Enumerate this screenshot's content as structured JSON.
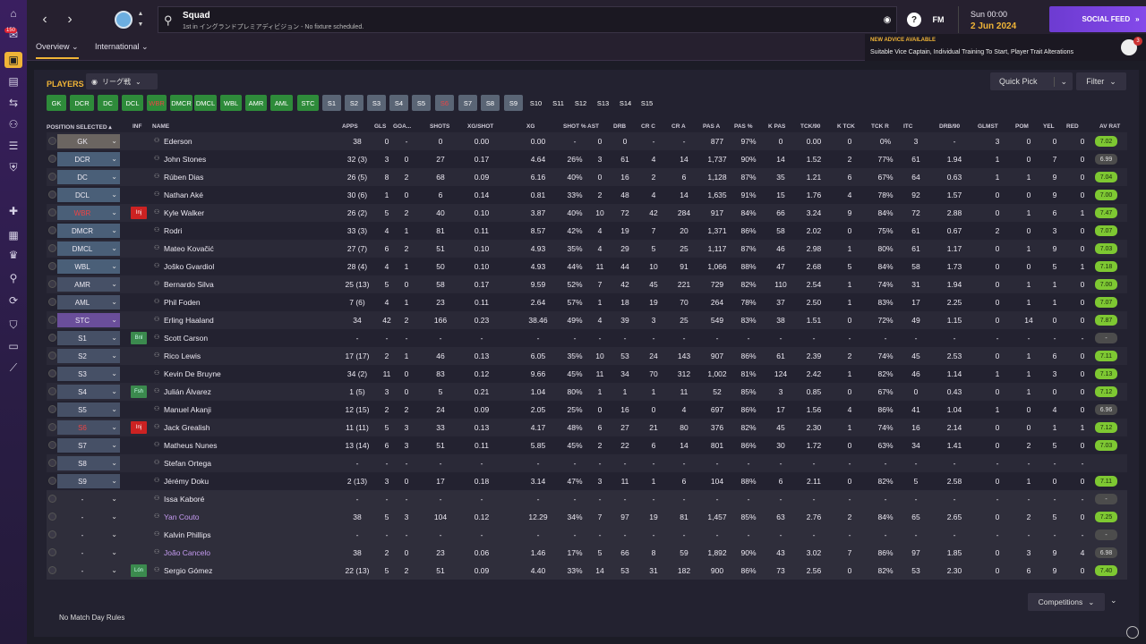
{
  "colors": {
    "accent": "#f0b437",
    "avr_good": "#7ec832",
    "avr_neutral": "#4c4c4c",
    "social": "#7a44e8"
  },
  "sidebar": {
    "badge": "150",
    "icons": [
      "home-icon",
      "inbox-icon",
      "squad-icon",
      "tactics-icon",
      "dynamics-icon",
      "staff-icon",
      "calendar-icon",
      "training-icon",
      "medical-icon",
      "schedule-icon",
      "competitions-icon",
      "scouting-icon",
      "transfers-icon",
      "club-info-icon",
      "finances-icon",
      "dev-centre-icon"
    ]
  },
  "header": {
    "title": "Squad",
    "subtitle": "1st in イングランドプレミアディビジョン - No fixture scheduled.",
    "fm_label": "FM",
    "date_line1": "Sun 00:00",
    "date_line2": "2 Jun 2024",
    "continue_label": "SOCIAL FEED",
    "tabs": [
      "Overview",
      "International"
    ],
    "advice_title": "NEW ADVICE AVAILABLE",
    "advice_text": "Suitable Vice Captain, Individual Training To Start, Player Trait Alterations",
    "advice_count": "3"
  },
  "panel": {
    "title": "PLAYERS",
    "view_label": "リーグ戦",
    "quickpick_label": "Quick Pick",
    "filter_label": "Filter",
    "positions": [
      "GK",
      "DCR",
      "DC",
      "DCL",
      "WBR",
      "DMCR",
      "DMCL",
      "WBL",
      "AMR",
      "AML",
      "STC",
      "S1",
      "S2",
      "S3",
      "S4",
      "S5",
      "S6",
      "S7",
      "S8",
      "S9",
      "S10",
      "S11",
      "S12",
      "S13",
      "S14",
      "S15"
    ],
    "columns": [
      "POSITION SELECTED",
      "INF",
      "NAME",
      "APPS",
      "GLS",
      "GOA...",
      "SHOTS",
      "XG/SHOT",
      "XG",
      "SHOT %",
      "AST",
      "DRB",
      "CR C",
      "CR A",
      "PAS A",
      "PAS %",
      "K PAS",
      "TCK/90",
      "K TCK",
      "TCK R",
      "ITC",
      "DRB/90",
      "GLMST",
      "POM",
      "YEL",
      "RED",
      "AV RAT"
    ],
    "rows": [
      {
        "pos": "GK",
        "inf": "",
        "name": "Ederson",
        "v": [
          "38",
          "0",
          "-",
          "0",
          "0.00",
          "0.00",
          "-",
          "0",
          "0",
          "-",
          "-",
          "877",
          "97%",
          "0",
          "0.00",
          "0",
          "0%",
          "3",
          "-",
          "3",
          "0",
          "0",
          "0"
        ],
        "rat": "7.02"
      },
      {
        "pos": "DCR",
        "inf": "",
        "name": "John Stones",
        "v": [
          "32 (3)",
          "3",
          "0",
          "27",
          "0.17",
          "4.64",
          "26%",
          "3",
          "61",
          "4",
          "14",
          "1,737",
          "90%",
          "14",
          "1.52",
          "2",
          "77%",
          "61",
          "1.94",
          "1",
          "0",
          "7",
          "0"
        ],
        "rat": "6.99"
      },
      {
        "pos": "DC",
        "inf": "",
        "name": "Rúben Dias",
        "v": [
          "26 (5)",
          "8",
          "2",
          "68",
          "0.09",
          "6.16",
          "40%",
          "0",
          "16",
          "2",
          "6",
          "1,128",
          "87%",
          "35",
          "1.21",
          "6",
          "67%",
          "64",
          "0.63",
          "1",
          "1",
          "9",
          "0"
        ],
        "rat": "7.04"
      },
      {
        "pos": "DCL",
        "inf": "",
        "name": "Nathan Aké",
        "v": [
          "30 (6)",
          "1",
          "0",
          "6",
          "0.14",
          "0.81",
          "33%",
          "2",
          "48",
          "4",
          "14",
          "1,635",
          "91%",
          "15",
          "1.76",
          "4",
          "78%",
          "92",
          "1.57",
          "0",
          "0",
          "9",
          "0"
        ],
        "rat": "7.00"
      },
      {
        "pos": "WBR",
        "inf": "Inj",
        "name": "Kyle Walker",
        "v": [
          "26 (2)",
          "5",
          "2",
          "40",
          "0.10",
          "3.87",
          "40%",
          "10",
          "72",
          "42",
          "284",
          "917",
          "84%",
          "66",
          "3.24",
          "9",
          "84%",
          "72",
          "2.88",
          "0",
          "1",
          "6",
          "1"
        ],
        "rat": "7.47"
      },
      {
        "pos": "DMCR",
        "inf": "",
        "name": "Rodri",
        "v": [
          "33 (3)",
          "4",
          "1",
          "81",
          "0.11",
          "8.57",
          "42%",
          "4",
          "19",
          "7",
          "20",
          "1,371",
          "86%",
          "58",
          "2.02",
          "0",
          "75%",
          "61",
          "0.67",
          "2",
          "0",
          "3",
          "0"
        ],
        "rat": "7.07"
      },
      {
        "pos": "DMCL",
        "inf": "",
        "name": "Mateo Kovačić",
        "v": [
          "27 (7)",
          "6",
          "2",
          "51",
          "0.10",
          "4.93",
          "35%",
          "4",
          "29",
          "5",
          "25",
          "1,117",
          "87%",
          "46",
          "2.98",
          "1",
          "80%",
          "61",
          "1.17",
          "0",
          "1",
          "9",
          "0"
        ],
        "rat": "7.03"
      },
      {
        "pos": "WBL",
        "inf": "",
        "name": "Joško Gvardiol",
        "v": [
          "28 (4)",
          "4",
          "1",
          "50",
          "0.10",
          "4.93",
          "44%",
          "11",
          "44",
          "10",
          "91",
          "1,066",
          "88%",
          "47",
          "2.68",
          "5",
          "84%",
          "58",
          "1.73",
          "0",
          "0",
          "5",
          "1"
        ],
        "rat": "7.18"
      },
      {
        "pos": "AMR",
        "inf": "",
        "name": "Bernardo Silva",
        "v": [
          "25 (13)",
          "5",
          "0",
          "58",
          "0.17",
          "9.59",
          "52%",
          "7",
          "42",
          "45",
          "221",
          "729",
          "82%",
          "110",
          "2.54",
          "1",
          "74%",
          "31",
          "1.94",
          "0",
          "1",
          "1",
          "0"
        ],
        "rat": "7.00"
      },
      {
        "pos": "AML",
        "inf": "",
        "name": "Phil Foden",
        "v": [
          "7 (6)",
          "4",
          "1",
          "23",
          "0.11",
          "2.64",
          "57%",
          "1",
          "18",
          "19",
          "70",
          "264",
          "78%",
          "37",
          "2.50",
          "1",
          "83%",
          "17",
          "2.25",
          "0",
          "1",
          "1",
          "0"
        ],
        "rat": "7.07"
      },
      {
        "pos": "STC",
        "inf": "",
        "name": "Erling Haaland",
        "v": [
          "34",
          "42",
          "2",
          "166",
          "0.23",
          "38.46",
          "49%",
          "4",
          "39",
          "3",
          "25",
          "549",
          "83%",
          "38",
          "1.51",
          "0",
          "72%",
          "49",
          "1.15",
          "0",
          "14",
          "0",
          "0"
        ],
        "rat": "7.87"
      },
      {
        "pos": "S1",
        "inf": "Bnl",
        "name": "Scott Carson",
        "v": [
          "-",
          "-",
          "-",
          "-",
          "-",
          "-",
          "-",
          "-",
          "-",
          "-",
          "-",
          "-",
          "-",
          "-",
          "-",
          "-",
          "-",
          "-",
          "-",
          "-",
          "-",
          "-",
          "-"
        ],
        "rat": "-"
      },
      {
        "pos": "S2",
        "inf": "",
        "name": "Rico Lewis",
        "v": [
          "17 (17)",
          "2",
          "1",
          "46",
          "0.13",
          "6.05",
          "35%",
          "10",
          "53",
          "24",
          "143",
          "907",
          "86%",
          "61",
          "2.39",
          "2",
          "74%",
          "45",
          "2.53",
          "0",
          "1",
          "6",
          "0"
        ],
        "rat": "7.11"
      },
      {
        "pos": "S3",
        "inf": "",
        "name": "Kevin De Bruyne",
        "v": [
          "34 (2)",
          "11",
          "0",
          "83",
          "0.12",
          "9.66",
          "45%",
          "11",
          "34",
          "70",
          "312",
          "1,002",
          "81%",
          "124",
          "2.42",
          "1",
          "82%",
          "46",
          "1.14",
          "1",
          "1",
          "3",
          "0"
        ],
        "rat": "7.13"
      },
      {
        "pos": "S4",
        "inf": "Fsh",
        "name": "Julián Álvarez",
        "v": [
          "1 (5)",
          "3",
          "0",
          "5",
          "0.21",
          "1.04",
          "80%",
          "1",
          "1",
          "1",
          "11",
          "52",
          "85%",
          "3",
          "0.85",
          "0",
          "67%",
          "0",
          "0.43",
          "0",
          "1",
          "0",
          "0"
        ],
        "rat": "7.12"
      },
      {
        "pos": "S5",
        "inf": "",
        "name": "Manuel Akanji",
        "v": [
          "12 (15)",
          "2",
          "2",
          "24",
          "0.09",
          "2.05",
          "25%",
          "0",
          "16",
          "0",
          "4",
          "697",
          "86%",
          "17",
          "1.56",
          "4",
          "86%",
          "41",
          "1.04",
          "1",
          "0",
          "4",
          "0"
        ],
        "rat": "6.96"
      },
      {
        "pos": "S6",
        "inf": "Inj",
        "name": "Jack Grealish",
        "v": [
          "11 (11)",
          "5",
          "3",
          "33",
          "0.13",
          "4.17",
          "48%",
          "6",
          "27",
          "21",
          "80",
          "376",
          "82%",
          "45",
          "2.30",
          "1",
          "74%",
          "16",
          "2.14",
          "0",
          "0",
          "1",
          "1"
        ],
        "rat": "7.12"
      },
      {
        "pos": "S7",
        "inf": "",
        "name": "Matheus Nunes",
        "v": [
          "13 (14)",
          "6",
          "3",
          "51",
          "0.11",
          "5.85",
          "45%",
          "2",
          "22",
          "6",
          "14",
          "801",
          "86%",
          "30",
          "1.72",
          "0",
          "63%",
          "34",
          "1.41",
          "0",
          "2",
          "5",
          "0"
        ],
        "rat": "7.03"
      },
      {
        "pos": "S8",
        "inf": "",
        "name": "Stefan Ortega",
        "v": [
          "-",
          "-",
          "-",
          "-",
          "-",
          "-",
          "-",
          "-",
          "-",
          "-",
          "-",
          "-",
          "-",
          "-",
          "-",
          "-",
          "-",
          "-",
          "-",
          "-",
          "-",
          "-",
          "-"
        ],
        "rat": ""
      },
      {
        "pos": "S9",
        "inf": "",
        "name": "Jérémy Doku",
        "v": [
          "2 (13)",
          "3",
          "0",
          "17",
          "0.18",
          "3.14",
          "47%",
          "3",
          "11",
          "1",
          "6",
          "104",
          "88%",
          "6",
          "2.11",
          "0",
          "82%",
          "5",
          "2.58",
          "0",
          "1",
          "0",
          "0"
        ],
        "rat": "7.11"
      },
      {
        "pos": "-",
        "inf": "",
        "name": "Issa Kaboré",
        "v": [
          "-",
          "-",
          "-",
          "-",
          "-",
          "-",
          "-",
          "-",
          "-",
          "-",
          "-",
          "-",
          "-",
          "-",
          "-",
          "-",
          "-",
          "-",
          "-",
          "-",
          "-",
          "-",
          "-"
        ],
        "rat": "-"
      },
      {
        "pos": "-",
        "inf": "",
        "name": "Yan Couto",
        "v": [
          "38",
          "5",
          "3",
          "104",
          "0.12",
          "12.29",
          "34%",
          "7",
          "97",
          "19",
          "81",
          "1,457",
          "85%",
          "63",
          "2.76",
          "2",
          "84%",
          "65",
          "2.65",
          "0",
          "2",
          "5",
          "0"
        ],
        "rat": "7.25"
      },
      {
        "pos": "-",
        "inf": "",
        "name": "Kalvin Phillips",
        "v": [
          "-",
          "-",
          "-",
          "-",
          "-",
          "-",
          "-",
          "-",
          "-",
          "-",
          "-",
          "-",
          "-",
          "-",
          "-",
          "-",
          "-",
          "-",
          "-",
          "-",
          "-",
          "-",
          "-"
        ],
        "rat": "-"
      },
      {
        "pos": "-",
        "inf": "",
        "name": "João Cancelo",
        "v": [
          "38",
          "2",
          "0",
          "23",
          "0.06",
          "1.46",
          "17%",
          "5",
          "66",
          "8",
          "59",
          "1,892",
          "90%",
          "43",
          "3.02",
          "7",
          "86%",
          "97",
          "1.85",
          "0",
          "3",
          "9",
          "4"
        ],
        "rat": "6.98"
      },
      {
        "pos": "-",
        "inf": "Lón",
        "name": "Sergio Gómez",
        "v": [
          "22 (13)",
          "5",
          "2",
          "51",
          "0.09",
          "4.40",
          "33%",
          "14",
          "53",
          "31",
          "182",
          "900",
          "86%",
          "73",
          "2.56",
          "0",
          "82%",
          "53",
          "2.30",
          "0",
          "6",
          "9",
          "0"
        ],
        "rat": "7.40"
      }
    ],
    "no_match_rules": "No Match Day Rules",
    "competitions_label": "Competitions"
  }
}
